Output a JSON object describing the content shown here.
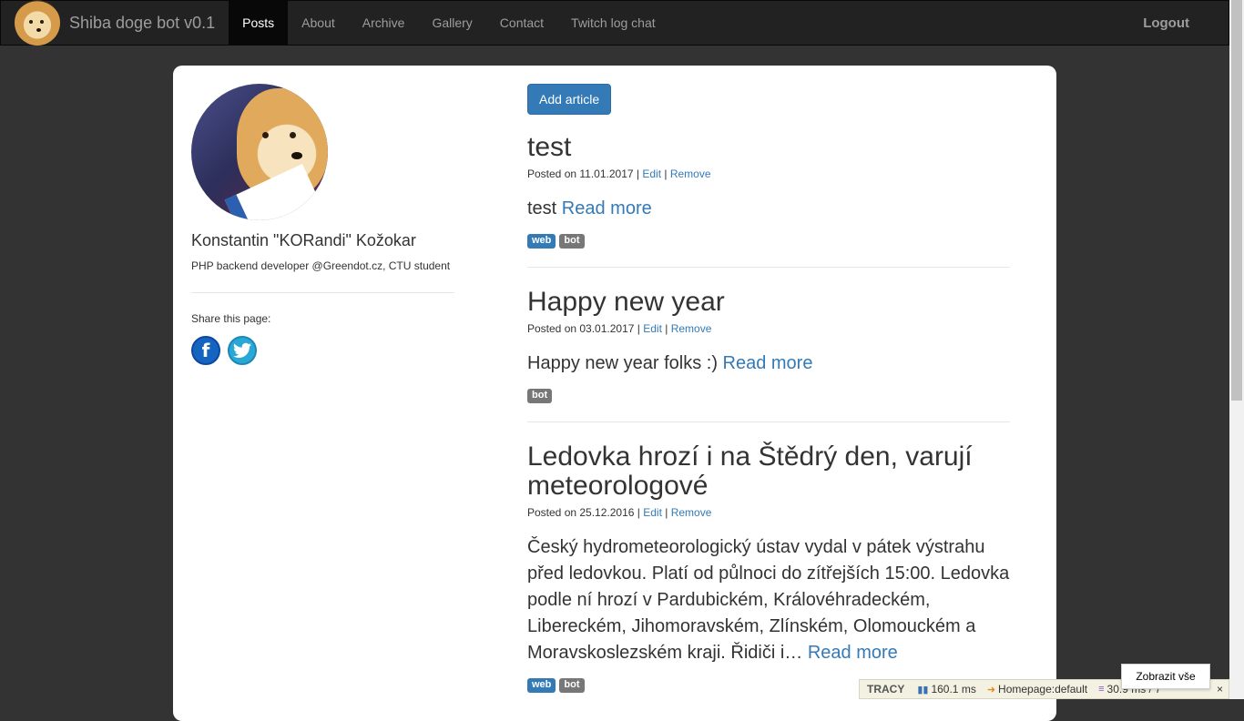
{
  "navbar": {
    "brand": "Shiba doge bot v0.1",
    "items": [
      {
        "label": "Posts",
        "active": true
      },
      {
        "label": "About"
      },
      {
        "label": "Archive"
      },
      {
        "label": "Gallery"
      },
      {
        "label": "Contact"
      },
      {
        "label": "Twitch log chat"
      }
    ],
    "logout": "Logout"
  },
  "sidebar": {
    "name": "Konstantin \"KORandi\" Kožokar",
    "bio": "PHP backend developer @Greendot.cz, CTU student",
    "share_label": "Share this page:",
    "share_icons": [
      "facebook-icon",
      "twitter-icon"
    ]
  },
  "main": {
    "add_button": "Add article",
    "posts": [
      {
        "title": "test",
        "posted_prefix": "Posted on ",
        "date": "11.01.2017",
        "edit": "Edit",
        "remove": "Remove",
        "excerpt": "test ",
        "read_more": "Read more",
        "tags": [
          "web",
          "bot"
        ]
      },
      {
        "title": "Happy new year",
        "posted_prefix": "Posted on ",
        "date": "03.01.2017",
        "edit": "Edit",
        "remove": "Remove",
        "excerpt": "Happy new year folks :) ",
        "read_more": "Read more",
        "tags": [
          "bot"
        ]
      },
      {
        "title": "Ledovka hrozí i na Štědrý den, varují meteorologové",
        "posted_prefix": "Posted on ",
        "date": "25.12.2016",
        "edit": "Edit",
        "remove": "Remove",
        "excerpt": "Český hydrometeorologický ústav vydal v pátek výstrahu před ledovkou. Platí od půlnoci do zítřejších 15:00. Ledovka podle ní hrozí v Pardubickém, Královéhradeckém, Libereckém, Jihomoravském, Zlínském, Olomouckém a Moravskoslezském kraji. Řidiči i… ",
        "read_more": "Read more",
        "tags": [
          "web",
          "bot"
        ]
      }
    ]
  },
  "tracy": {
    "logo": "TRACY",
    "time": "160.1 ms",
    "route": "Homepage:default",
    "db": "30.9 ms / 7",
    "popup": "Zobrazit vše",
    "close": "×"
  },
  "colors": {
    "accent": "#337ab7",
    "navbar": "#222222",
    "page_bg": "#333333"
  }
}
